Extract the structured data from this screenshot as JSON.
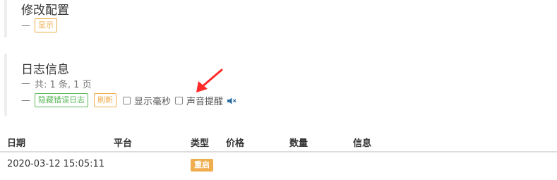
{
  "config_section": {
    "title": "修改配置",
    "dash": "—",
    "show_label": "显示"
  },
  "log_section": {
    "title": "日志信息",
    "dash": "—",
    "summary": "共: 1 条, 1 页",
    "hide_error_label": "隐藏错误日志",
    "refresh_label": "刷新",
    "show_ms_label": "显示毫秒",
    "sound_alert_label": "声音提醒",
    "show_ms_checked": false,
    "sound_alert_checked": false
  },
  "table": {
    "headers": [
      "日期",
      "平台",
      "类型",
      "价格",
      "数量",
      "信息"
    ],
    "rows": [
      {
        "date": "2020-03-12 15:05:11",
        "platform": "",
        "type": "重启",
        "price": "",
        "amount": "",
        "info": ""
      }
    ]
  },
  "icons": {
    "sound": "speaker-muted-icon",
    "annotation": "red-arrow"
  },
  "colors": {
    "warning": "#f0ad4e",
    "success": "#5cb85c",
    "annotation_arrow": "#ff2a2a",
    "speaker_icon": "#2e6da4"
  }
}
